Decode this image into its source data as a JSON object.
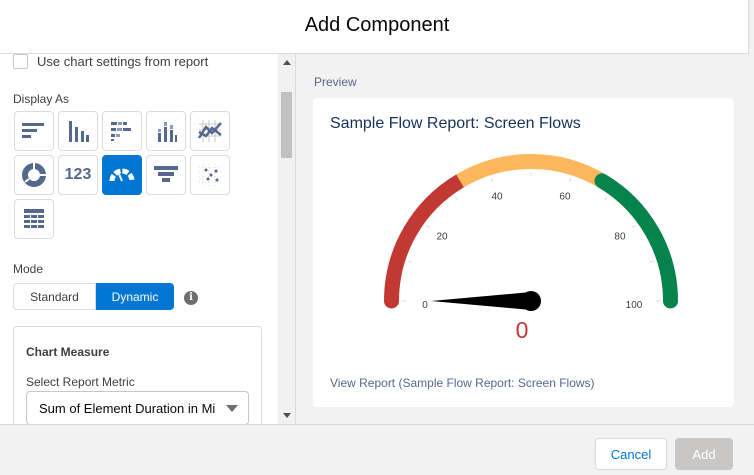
{
  "modal": {
    "title": "Add Component"
  },
  "left": {
    "use_report_settings_label": "Use chart settings from report",
    "display_as_label": "Display As",
    "chart_types": [
      {
        "name": "horizontal-bar",
        "selected": false
      },
      {
        "name": "vertical-bar",
        "selected": false
      },
      {
        "name": "stacked-horizontal-bar",
        "selected": false
      },
      {
        "name": "stacked-vertical-bar",
        "selected": false
      },
      {
        "name": "line",
        "selected": false
      },
      {
        "name": "donut",
        "selected": false
      },
      {
        "name": "metric",
        "selected": false,
        "text": "123"
      },
      {
        "name": "gauge",
        "selected": true
      },
      {
        "name": "funnel",
        "selected": false
      },
      {
        "name": "scatter",
        "selected": false
      },
      {
        "name": "table",
        "selected": false
      }
    ],
    "mode_label": "Mode",
    "mode_standard": "Standard",
    "mode_dynamic": "Dynamic",
    "info_glyph": "i",
    "measure_title": "Chart Measure",
    "metric_label": "Select Report Metric",
    "metric_value": "Sum of Element Duration in Mi"
  },
  "preview": {
    "label": "Preview",
    "title": "Sample Flow Report: Screen Flows",
    "view_report": "View Report (Sample Flow Report: Screen Flows)",
    "gauge": {
      "min": 0,
      "max": 100,
      "value": 0,
      "value_text": "0",
      "ticks": [
        "0",
        "20",
        "40",
        "60",
        "80",
        "100"
      ],
      "segments": [
        {
          "from": 0,
          "to": 33,
          "color": "#c23934"
        },
        {
          "from": 33,
          "to": 67,
          "color": "#ffb75d"
        },
        {
          "from": 67,
          "to": 100,
          "color": "#04844b"
        }
      ],
      "needle_color": "#000000",
      "value_color": "#c23934"
    }
  },
  "footer": {
    "cancel": "Cancel",
    "add": "Add"
  }
}
